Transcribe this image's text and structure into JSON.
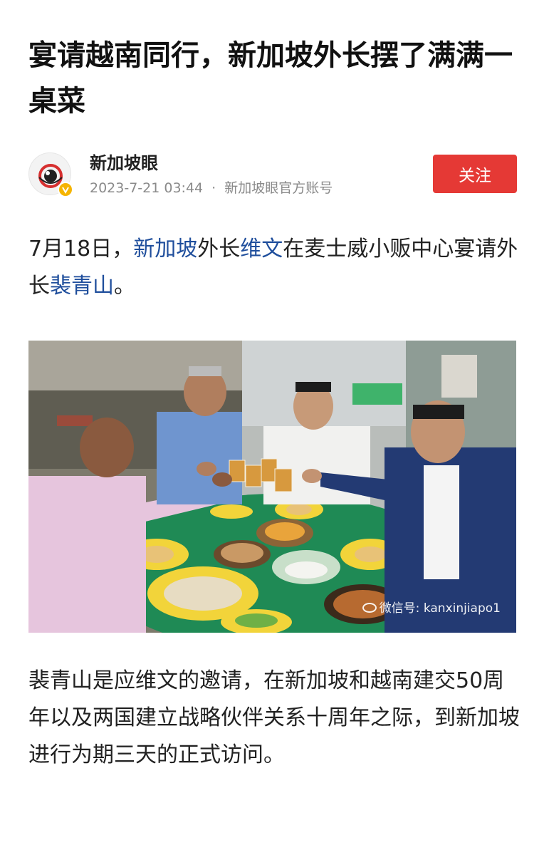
{
  "article": {
    "title": "宴请越南同行，新加坡外长摆了满满一桌菜"
  },
  "author": {
    "name": "新加坡眼",
    "date": "2023-7-21 03:44",
    "separator": "·",
    "account_type": "新加坡眼官方账号",
    "avatar_icon": "logo-eye-icon",
    "avatar_text": "新加坡眼",
    "verified_icon": "verified-badge-icon"
  },
  "follow_button": {
    "label": "关注",
    "color": "#e53935"
  },
  "paragraph1": {
    "p1": "7月18日，",
    "link1": "新加坡",
    "p2": "外长",
    "link2": "维文",
    "p3": "在麦士威小贩中心宴请外长",
    "link3": "裴青山",
    "p4": "。"
  },
  "photo": {
    "watermark": "微信号: kanxinjiapo1",
    "watermark_icon": "wechat-icon"
  },
  "paragraph2": {
    "text": "裴青山是应维文的邀请，在新加坡和越南建交50周年以及两国建立战略伙伴关系十周年之际，到新加坡进行为期三天的正式访问。"
  },
  "colors": {
    "link": "#1f4e9c",
    "meta": "#8a8a8a",
    "accent": "#e53935"
  }
}
